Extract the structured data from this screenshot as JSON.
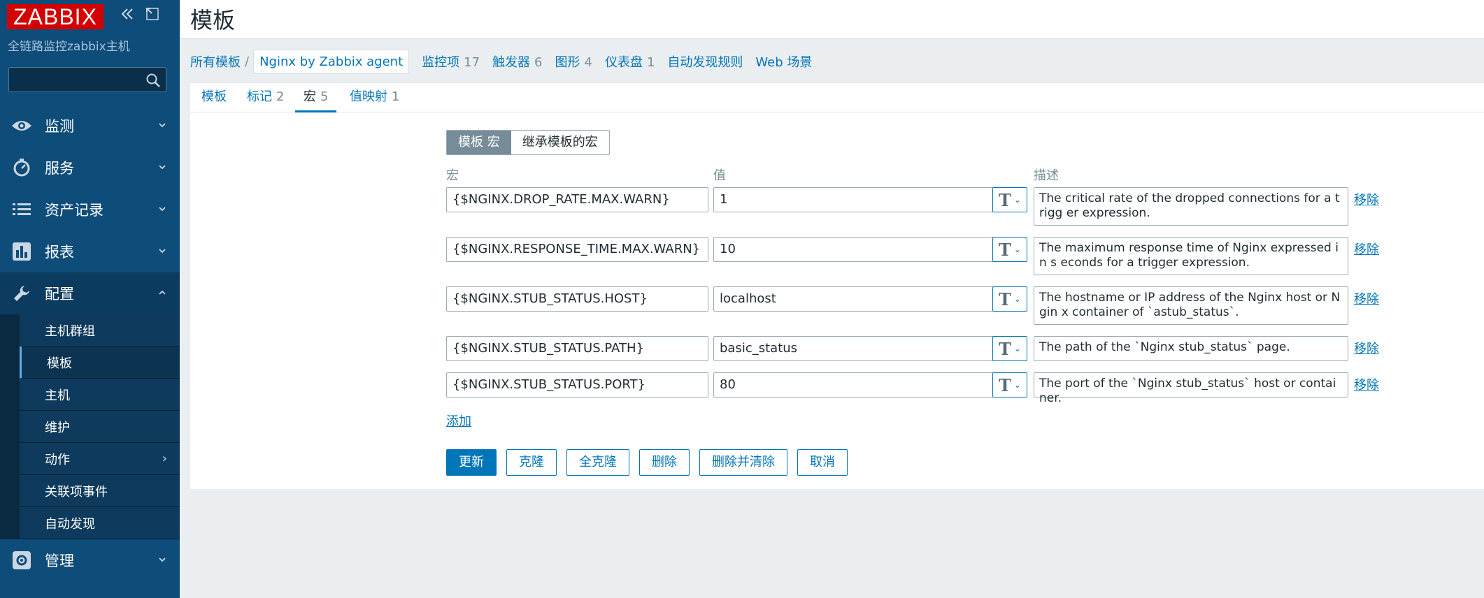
{
  "sidebar": {
    "logo": "ZABBIX",
    "server_name": "全链路监控zabbix主机",
    "search_placeholder": "",
    "nav": [
      {
        "label": "监测",
        "icon": "eye-icon"
      },
      {
        "label": "服务",
        "icon": "clock-icon"
      },
      {
        "label": "资产记录",
        "icon": "list-icon"
      },
      {
        "label": "报表",
        "icon": "bar-chart-icon"
      },
      {
        "label": "配置",
        "icon": "wrench-icon"
      },
      {
        "label": "管理",
        "icon": "gear-icon"
      }
    ],
    "submenu": [
      "主机群组",
      "模板",
      "主机",
      "维护",
      "动作",
      "关联项事件",
      "自动发现"
    ]
  },
  "header": {
    "title": "模板"
  },
  "breadcrumb": {
    "all_templates": "所有模板",
    "separator": "/",
    "current": "Nginx by Zabbix agent",
    "links": [
      {
        "label": "监控项",
        "count": "17"
      },
      {
        "label": "触发器",
        "count": "6"
      },
      {
        "label": "图形",
        "count": "4"
      },
      {
        "label": "仪表盘",
        "count": "1"
      },
      {
        "label": "自动发现规则",
        "count": ""
      },
      {
        "label": "Web 场景",
        "count": ""
      }
    ]
  },
  "tabs": [
    {
      "label": "模板",
      "count": ""
    },
    {
      "label": "标记",
      "count": "2"
    },
    {
      "label": "宏",
      "count": "5"
    },
    {
      "label": "值映射",
      "count": "1"
    }
  ],
  "toggle": {
    "template_macros": "模板 宏",
    "inherited_macros": "继承模板的宏"
  },
  "columns": {
    "macro": "宏",
    "value": "值",
    "description": "描述"
  },
  "macros": [
    {
      "macro": "{$NGINX.DROP_RATE.MAX.WARN}",
      "value": "1",
      "description": "The critical rate of the dropped connections for a trigg er expression.",
      "remove": "移除"
    },
    {
      "macro": "{$NGINX.RESPONSE_TIME.MAX.WARN}",
      "value": "10",
      "description": "The maximum response time of Nginx expressed in s econds for a trigger expression.",
      "remove": "移除"
    },
    {
      "macro": "{$NGINX.STUB_STATUS.HOST}",
      "value": "localhost",
      "description": "The hostname or IP address of the Nginx host or Ngin x container of `astub_status`.",
      "remove": "移除"
    },
    {
      "macro": "{$NGINX.STUB_STATUS.PATH}",
      "value": "basic_status",
      "description": "The path of the `Nginx stub_status` page.",
      "remove": "移除"
    },
    {
      "macro": "{$NGINX.STUB_STATUS.PORT}",
      "value": "80",
      "description": "The port of the `Nginx stub_status` host or container.",
      "remove": "移除"
    }
  ],
  "value_type_glyph": "T",
  "add_label": "添加",
  "buttons": {
    "update": "更新",
    "clone": "克隆",
    "full_clone": "全克隆",
    "delete": "删除",
    "delete_and_clear": "删除并清除",
    "cancel": "取消"
  },
  "colors": {
    "sidebar": "#0e4c7a",
    "accent": "#0275b8",
    "logo_red": "#d40000"
  }
}
